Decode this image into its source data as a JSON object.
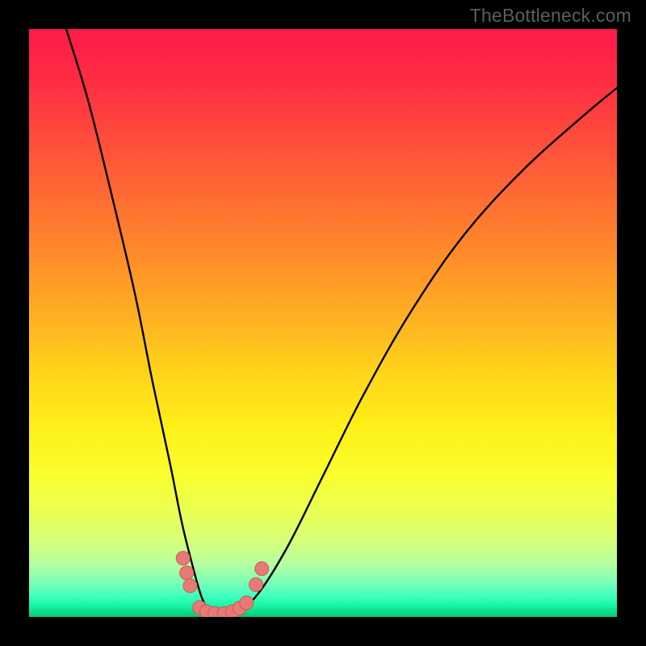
{
  "attribution": "TheBottleneck.com",
  "chart_data": {
    "type": "line",
    "title": "",
    "xlabel": "",
    "ylabel": "",
    "xlim": [
      0,
      100
    ],
    "ylim": [
      0,
      100
    ],
    "grid": false,
    "legend": false,
    "series": [
      {
        "name": "bottleneck-curve",
        "x": [
          6,
          10,
          14,
          18,
          21,
          24,
          26,
          28,
          29.5,
          31,
          33,
          35.5,
          39,
          44,
          50,
          57,
          65,
          74,
          84,
          94,
          100
        ],
        "y": [
          101,
          88,
          72,
          55,
          40,
          26,
          16,
          8,
          3,
          1,
          0.5,
          1,
          4,
          12,
          24,
          38,
          52,
          65,
          76,
          85,
          90
        ]
      }
    ],
    "markers": {
      "name": "threshold-beads",
      "points": [
        {
          "x": 26.2,
          "y": 10.0
        },
        {
          "x": 26.8,
          "y": 7.5
        },
        {
          "x": 27.4,
          "y": 5.3
        },
        {
          "x": 29.0,
          "y": 1.6
        },
        {
          "x": 30.2,
          "y": 0.9
        },
        {
          "x": 31.6,
          "y": 0.6
        },
        {
          "x": 33.2,
          "y": 0.6
        },
        {
          "x": 34.6,
          "y": 0.9
        },
        {
          "x": 35.8,
          "y": 1.5
        },
        {
          "x": 37.0,
          "y": 2.4
        },
        {
          "x": 38.6,
          "y": 5.5
        },
        {
          "x": 39.6,
          "y": 8.2
        }
      ]
    },
    "background_gradient": {
      "top": "#ff1a4b",
      "mid": "#fff019",
      "bottom": "#09c877"
    }
  }
}
